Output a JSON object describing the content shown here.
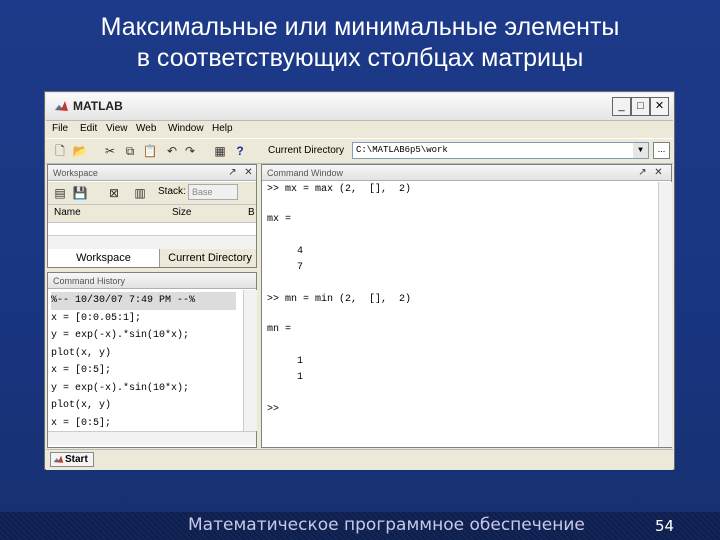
{
  "slide": {
    "title_line1": "Максимальные или минимальные элементы",
    "title_line2": "в соответствующих столбцах матрицы",
    "footer": "Математическое программное обеспечение",
    "page_number": "54"
  },
  "window": {
    "title": "MATLAB",
    "min_label": "_",
    "max_label": "□",
    "close_label": "✕"
  },
  "menu": [
    "File",
    "Edit",
    "View",
    "Web",
    "Window",
    "Help"
  ],
  "toolbar": {
    "current_directory_label": "Current Directory",
    "current_directory_value": "C:\\MATLAB6p5\\work",
    "browse_label": "..."
  },
  "workspace": {
    "title": "Workspace",
    "stack_label": "Stack:",
    "stack_value": "Base",
    "col_name": "Name",
    "col_size": "Size",
    "col_bytes": "B",
    "tab_workspace": "Workspace",
    "tab_current_directory": "Current Directory"
  },
  "history": {
    "title": "Command History",
    "lines": [
      "%-- 10/30/07  7:49 PM --%",
      "x = [0:0.05:1];",
      "y = exp(-x).*sin(10*x);",
      "plot(x, y)",
      "x = [0:5];",
      "y = exp(-x).*sin(10*x);",
      "plot(x, y)",
      "x = [0:5];"
    ]
  },
  "command": {
    "title": "Command Window",
    "lines": [
      ">> mx = max (2,  [],  2)",
      "mx =",
      "     4",
      "     7",
      ">> mn = min (2,  [],  2)",
      "mn =",
      "     1",
      "     1",
      ">>"
    ]
  },
  "status": {
    "start_label": "Start"
  },
  "colors": {
    "slide_bg": "#1d3a8a",
    "window_bg": "#ece9d8"
  }
}
